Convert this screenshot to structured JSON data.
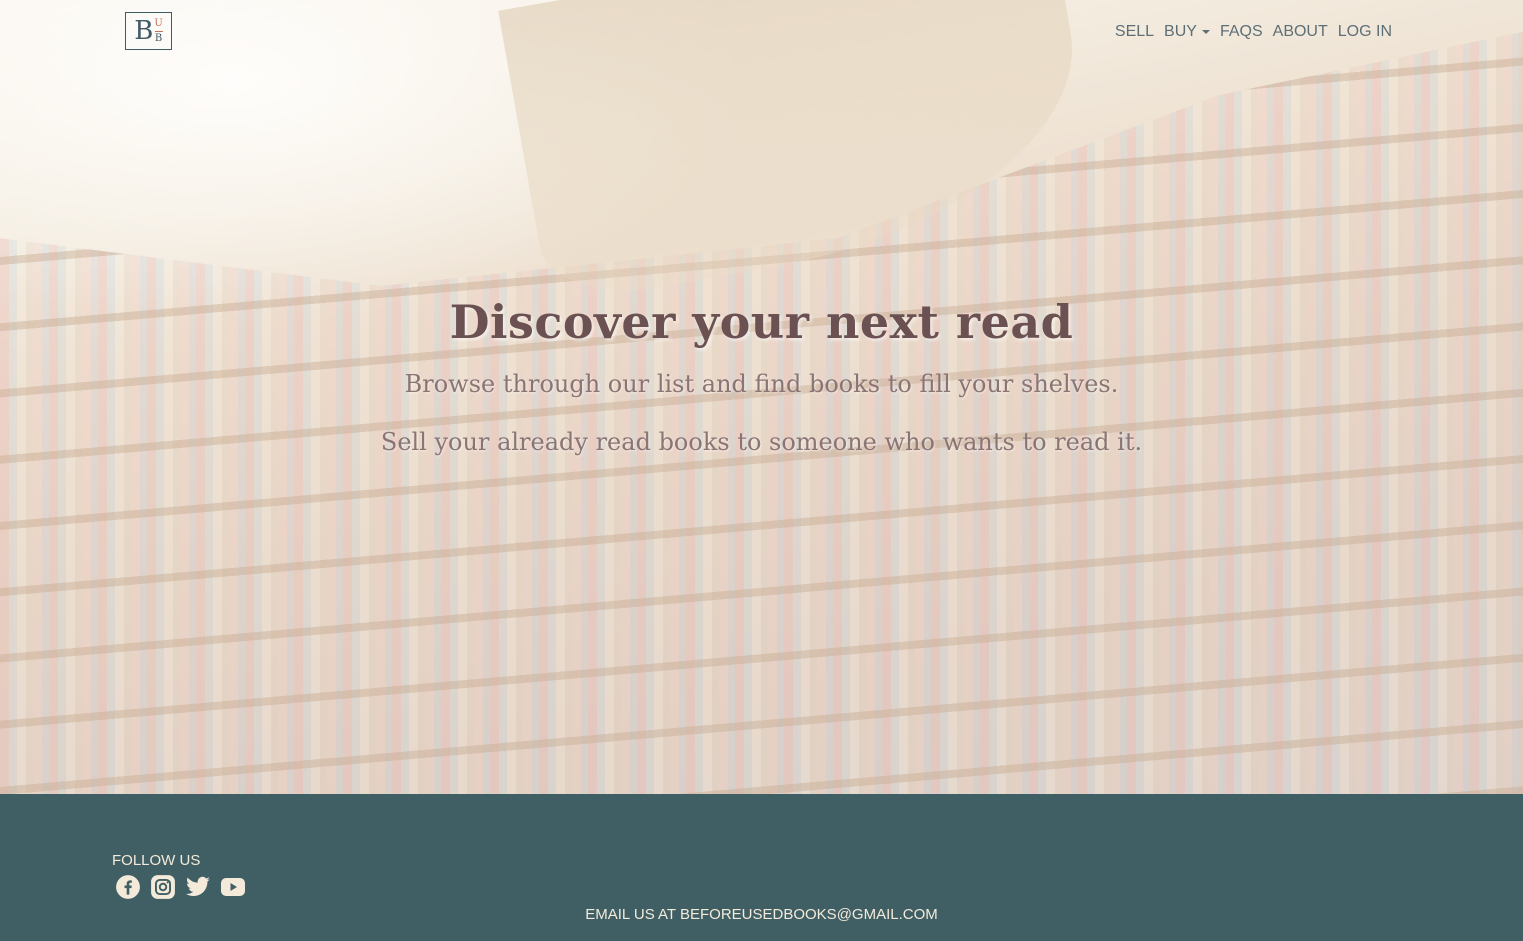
{
  "nav": {
    "logo": {
      "letter_main": "B",
      "letter_top": "U",
      "letter_bottom": "B"
    },
    "items": [
      {
        "label": "SELL",
        "dropdown": false
      },
      {
        "label": "BUY",
        "dropdown": true
      },
      {
        "label": "FAQS",
        "dropdown": false
      },
      {
        "label": "ABOUT",
        "dropdown": false
      },
      {
        "label": "LOG IN",
        "dropdown": false
      }
    ]
  },
  "hero": {
    "title": "Discover your next read",
    "subtitle_1": "Browse through our list and find books to fill your shelves.",
    "subtitle_2": "Sell your already read books to someone who wants to read it."
  },
  "footer": {
    "follow_label": "FOLLOW US",
    "social_icons": [
      "facebook-icon",
      "instagram-icon",
      "twitter-icon",
      "youtube-icon"
    ],
    "email_line": "EMAIL US AT BEFOREUSEDBOOKS@GMAIL.COM"
  },
  "colors": {
    "footer_bg": "#405f65",
    "footer_text": "#f3ead9",
    "title": "#6b5152",
    "subtitle": "#8a7474",
    "nav_text": "#5d6f77"
  }
}
